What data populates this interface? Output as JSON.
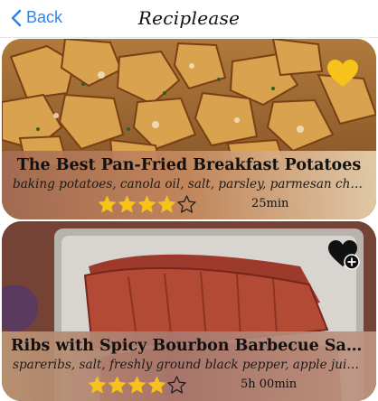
{
  "navbar": {
    "back_label": "Back",
    "title": "Reciplease"
  },
  "recipes": [
    {
      "title": "The Best Pan-Fried Breakfast Potatoes",
      "ingredients": "baking potatoes, canola oil, salt, parsley, parmesan cheese",
      "rating": 4,
      "rating_max": 5,
      "time": "25min",
      "favorite_icon": "heart-filled-icon"
    },
    {
      "title": "Ribs with Spicy Bourbon Barbecue Sauce",
      "ingredients": "spareribs, salt, freshly ground black pepper, apple juice, brown sugar",
      "rating": 4,
      "rating_max": 5,
      "time": "5h 00min",
      "favorite_icon": "heart-add-icon"
    }
  ],
  "colors": {
    "accent": "#2f86e8",
    "favorite": "#f7c21a",
    "star": "#f7c21a"
  }
}
